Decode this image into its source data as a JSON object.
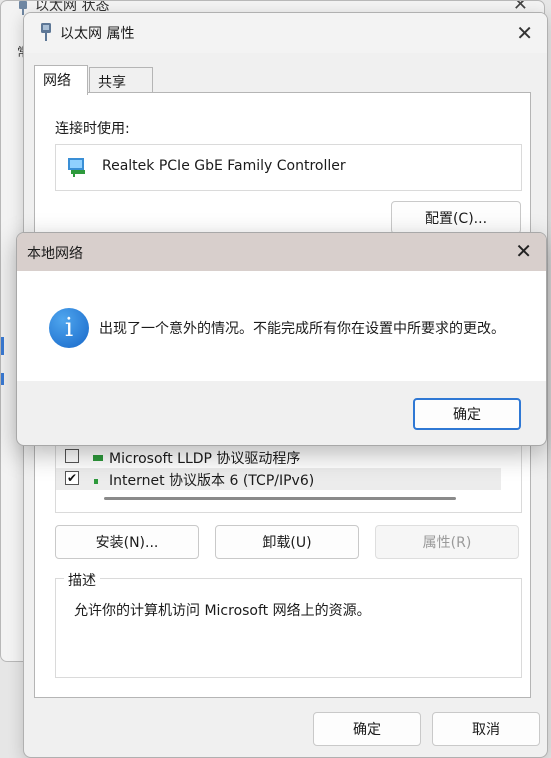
{
  "background_window": {
    "title": "以太网 状态",
    "partial_char": "常"
  },
  "properties_window": {
    "title": "以太网 属性",
    "tabs": [
      {
        "label": "网络",
        "active": true
      },
      {
        "label": "共享",
        "active": false
      }
    ],
    "connect_using_label": "连接时使用:",
    "adapter_name": "Realtek PCIe GbE Family Controller",
    "configure_button": "配置(C)...",
    "items": [
      {
        "label": "Microsoft LLDP 协议驱动程序",
        "checked": false
      },
      {
        "label": "Internet 协议版本 6 (TCP/IPv6)",
        "checked": true
      }
    ],
    "install_button": "安装(N)...",
    "uninstall_button": "卸载(U)",
    "properties_button": "属性(R)",
    "description_legend": "描述",
    "description_text": "允许你的计算机访问 Microsoft 网络上的资源。",
    "ok_button": "确定",
    "cancel_button": "取消"
  },
  "modal": {
    "title": "本地网络",
    "message": "出现了一个意外的情况。不能完成所有你在设置中所要求的更改。",
    "ok_button": "确定",
    "icon": "info-icon"
  },
  "colors": {
    "modal_titlebar": "#d8cfcc",
    "accent": "#2f78d4",
    "info_icon": "#1767c9"
  }
}
